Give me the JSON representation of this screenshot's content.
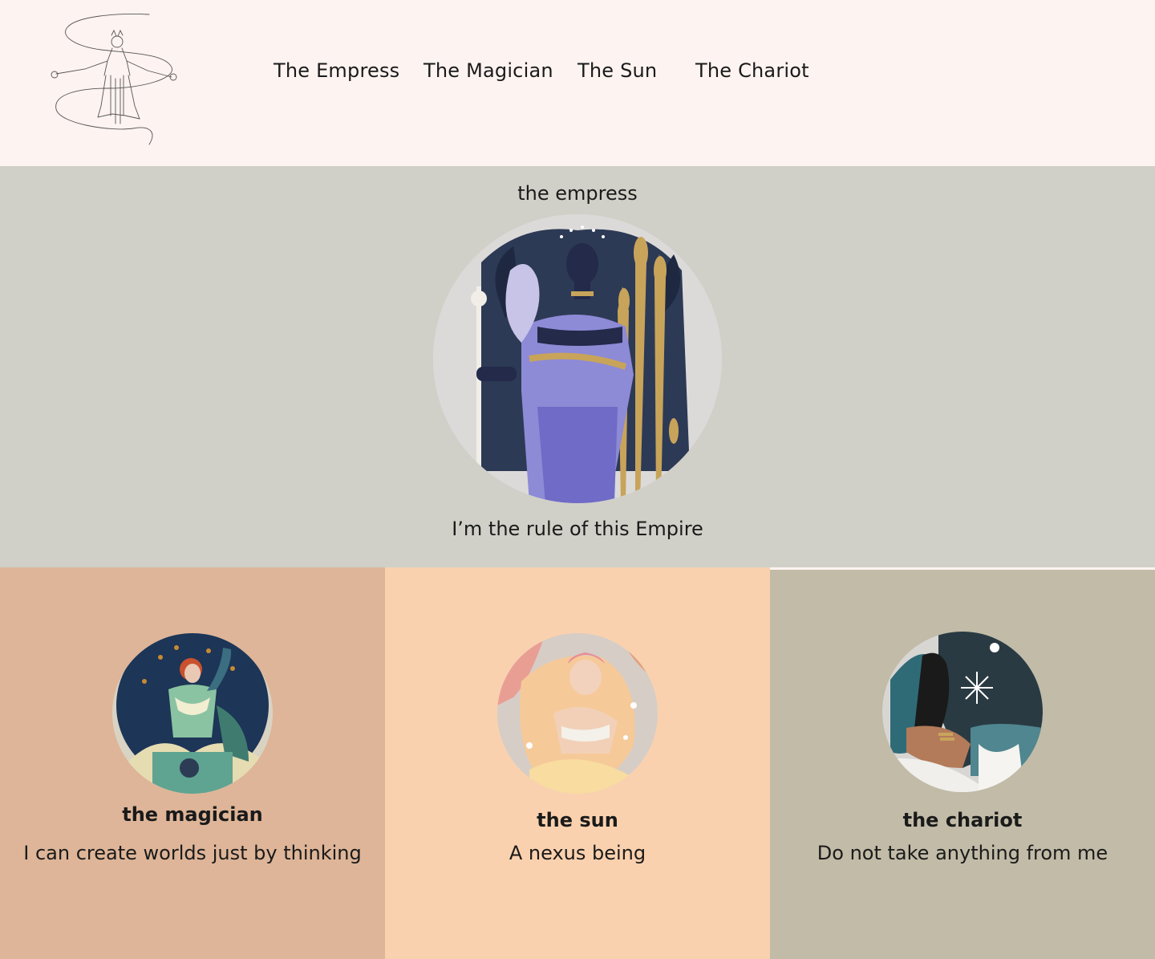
{
  "nav": {
    "items": [
      {
        "label": "The Empress"
      },
      {
        "label": "The Magician"
      },
      {
        "label": "The Sun"
      },
      {
        "label": "The Chariot"
      }
    ]
  },
  "hero": {
    "title": "the empress",
    "text": "I’m the rule of this Empire"
  },
  "cards": [
    {
      "name": "the magician",
      "desc": "I can create worlds just by thinking"
    },
    {
      "name": "the sun",
      "desc": "A nexus being"
    },
    {
      "name": "the chariot",
      "desc": "Do not take anything from me"
    }
  ]
}
